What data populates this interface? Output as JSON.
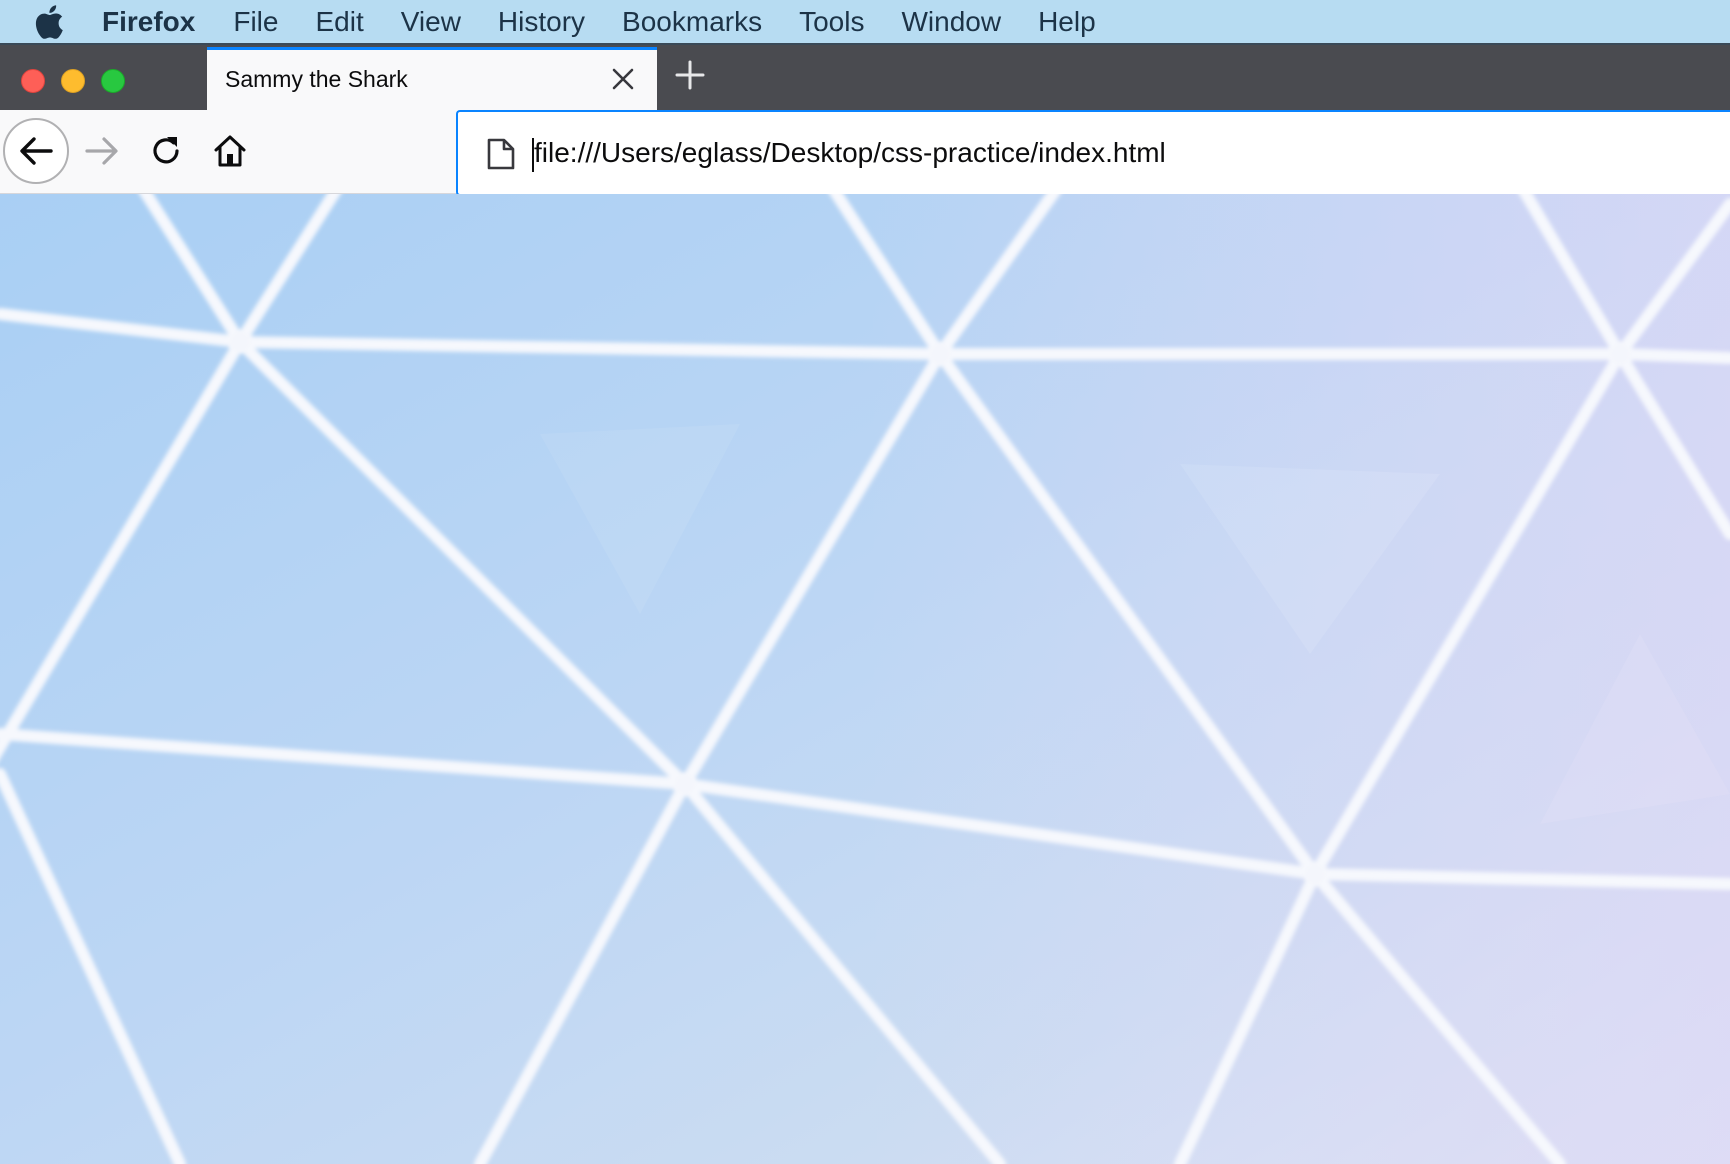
{
  "menubar": {
    "app_name": "Firefox",
    "items": [
      "File",
      "Edit",
      "View",
      "History",
      "Bookmarks",
      "Tools",
      "Window",
      "Help"
    ]
  },
  "tab": {
    "title": "Sammy the Shark"
  },
  "urlbar": {
    "value": "file:///Users/eglass/Desktop/css-practice/index.html"
  },
  "icons": {
    "apple": "apple-logo-icon",
    "tab_close": "close-icon",
    "new_tab": "plus-icon",
    "back": "arrow-left-icon",
    "forward": "arrow-right-icon",
    "reload": "reload-icon",
    "home": "home-icon",
    "page": "page-icon"
  },
  "colors": {
    "menubar_bg": "#b7dcf2",
    "tabstrip_bg": "#4a4b50",
    "accent": "#0a84ff",
    "toolbar_bg": "#f9f9fa"
  }
}
